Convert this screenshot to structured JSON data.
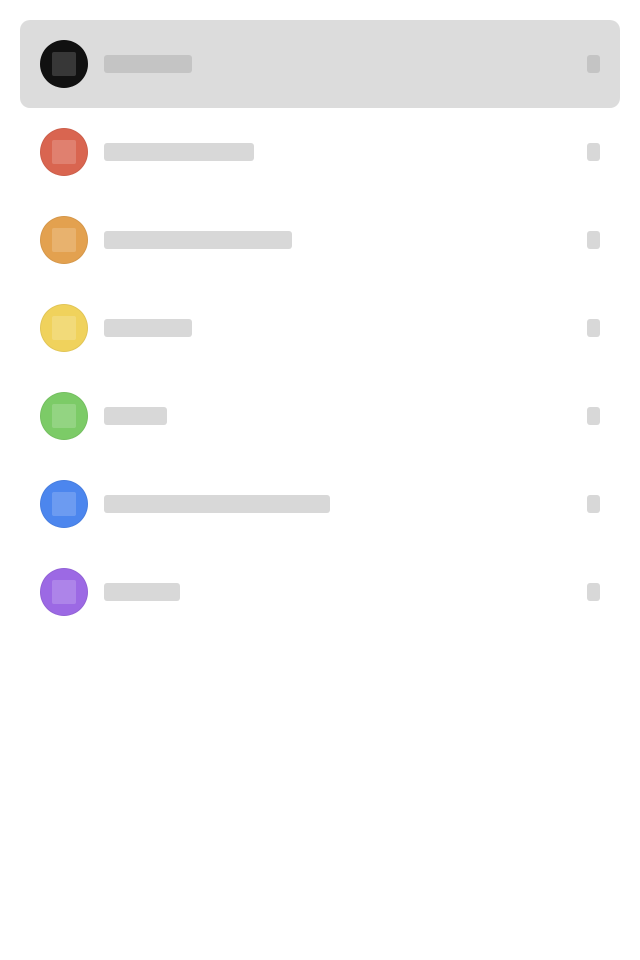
{
  "list": {
    "items": [
      {
        "color": "#111111",
        "label": "",
        "selected": true
      },
      {
        "color": "#d96550",
        "label": "",
        "selected": false
      },
      {
        "color": "#e3a14f",
        "label": "",
        "selected": false
      },
      {
        "color": "#f0d25c",
        "label": "",
        "selected": false
      },
      {
        "color": "#7ccb67",
        "label": "",
        "selected": false
      },
      {
        "color": "#4c86ee",
        "label": "",
        "selected": false
      },
      {
        "color": "#9c69e4",
        "label": "",
        "selected": false
      }
    ]
  }
}
